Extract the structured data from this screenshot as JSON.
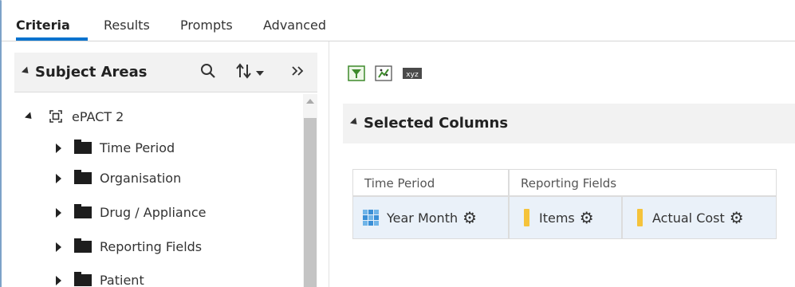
{
  "tabs": [
    {
      "label": "Criteria",
      "active": true
    },
    {
      "label": "Results"
    },
    {
      "label": "Prompts"
    },
    {
      "label": "Advanced"
    }
  ],
  "subject_areas": {
    "title": "Subject Areas",
    "icons": [
      "search-icon",
      "sort-icon",
      "dropdown-icon",
      "collapse-panel-icon"
    ],
    "root": "ePACT 2",
    "folders": [
      "Time Period",
      "Organisation",
      "Drug / Appliance",
      "Reporting Fields",
      "Patient"
    ]
  },
  "toolbar": {
    "icons": [
      "filter-icon",
      "edit-formula-icon",
      "xyz-icon"
    ],
    "xyz_label": "xyz"
  },
  "selected_columns": {
    "title": "Selected Columns",
    "groups": [
      "Time Period",
      "Reporting Fields"
    ],
    "columns": [
      "Year Month",
      "Items",
      "Actual Cost"
    ]
  },
  "colors": {
    "accent": "#0572ce",
    "header_bg": "#f2f2f2",
    "column_bg": "#eaf1f9",
    "measure": "#f5c33b",
    "filter_green": "#3e8a2c"
  }
}
